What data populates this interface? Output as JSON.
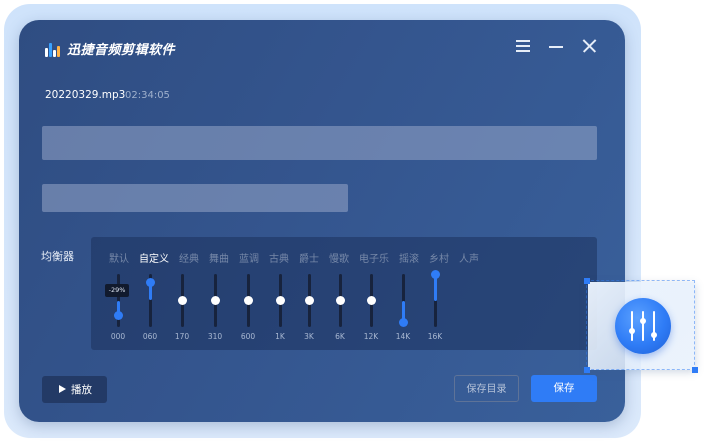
{
  "app": {
    "title": "迅捷音频剪辑软件"
  },
  "file": {
    "name": "20220329.mp3",
    "duration": "02:34:05"
  },
  "equalizer": {
    "label": "均衡器",
    "presets": [
      "默认",
      "自定义",
      "经典",
      "舞曲",
      "蓝调",
      "古典",
      "爵士",
      "慢歌",
      "电子乐",
      "摇滚",
      "乡村",
      "人声"
    ],
    "active_preset": "自定义",
    "tooltip": "-29%",
    "bands": [
      {
        "freq": "000",
        "level": 0.21
      },
      {
        "freq": "060",
        "level": 0.84
      },
      {
        "freq": "170",
        "level": 0.5
      },
      {
        "freq": "310",
        "level": 0.5
      },
      {
        "freq": "600",
        "level": 0.5
      },
      {
        "freq": "1K",
        "level": 0.5
      },
      {
        "freq": "3K",
        "level": 0.5
      },
      {
        "freq": "6K",
        "level": 0.5
      },
      {
        "freq": "12K",
        "level": 0.5
      },
      {
        "freq": "14K",
        "level": 0.09
      },
      {
        "freq": "16K",
        "level": 1.0
      }
    ]
  },
  "buttons": {
    "play": "播放",
    "save_dir": "保存目录",
    "save": "保存"
  },
  "colors": {
    "accent": "#2f7cf6",
    "window_bg": "#34558e",
    "panel_bg": "#1c325c"
  }
}
